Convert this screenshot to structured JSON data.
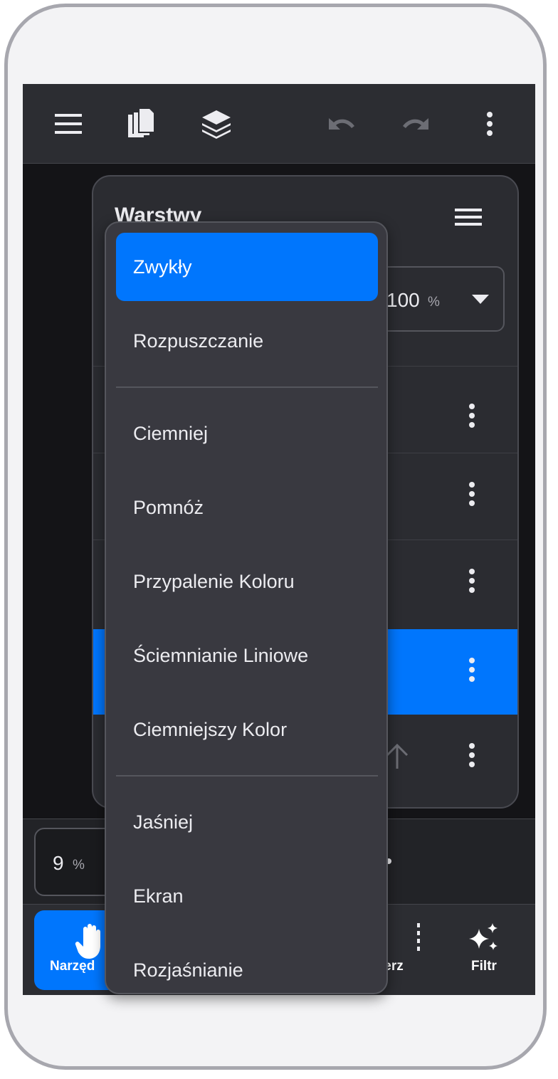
{
  "layers_panel": {
    "title": "Warstwy",
    "opacity": {
      "value": "100",
      "unit": "%"
    }
  },
  "size_control": {
    "value": "9",
    "unit": "%"
  },
  "bottom_nav": [
    {
      "label": "Narzędzia",
      "visible_label": "Narzęd",
      "active": true
    },
    {
      "label": "Wybierz",
      "visible_label": "ierz",
      "active": false
    },
    {
      "label": "Filtr",
      "visible_label": "Filtr",
      "active": false
    }
  ],
  "blend_mode_menu": {
    "selected": "Zwykły",
    "items": [
      "Zwykły",
      "Rozpuszczanie",
      "Ciemniej",
      "Pomnóż",
      "Przypalenie Koloru",
      "Ściemnianie Liniowe",
      "Ciemniejszy Kolor",
      "Jaśniej",
      "Ekran",
      "Rozjaśnianie"
    ]
  },
  "colors": {
    "accent": "#0076fd",
    "toolbar_bg": "#2c2d32",
    "menu_bg": "#393940"
  },
  "icons": {
    "menu": "hamburger-icon",
    "pages": "pages-icon",
    "layers": "layers-icon",
    "undo": "undo-icon",
    "redo": "redo-icon",
    "more": "more-vertical-icon",
    "hand": "hand-icon",
    "select": "selection-icon",
    "filter": "sparkle-icon"
  }
}
